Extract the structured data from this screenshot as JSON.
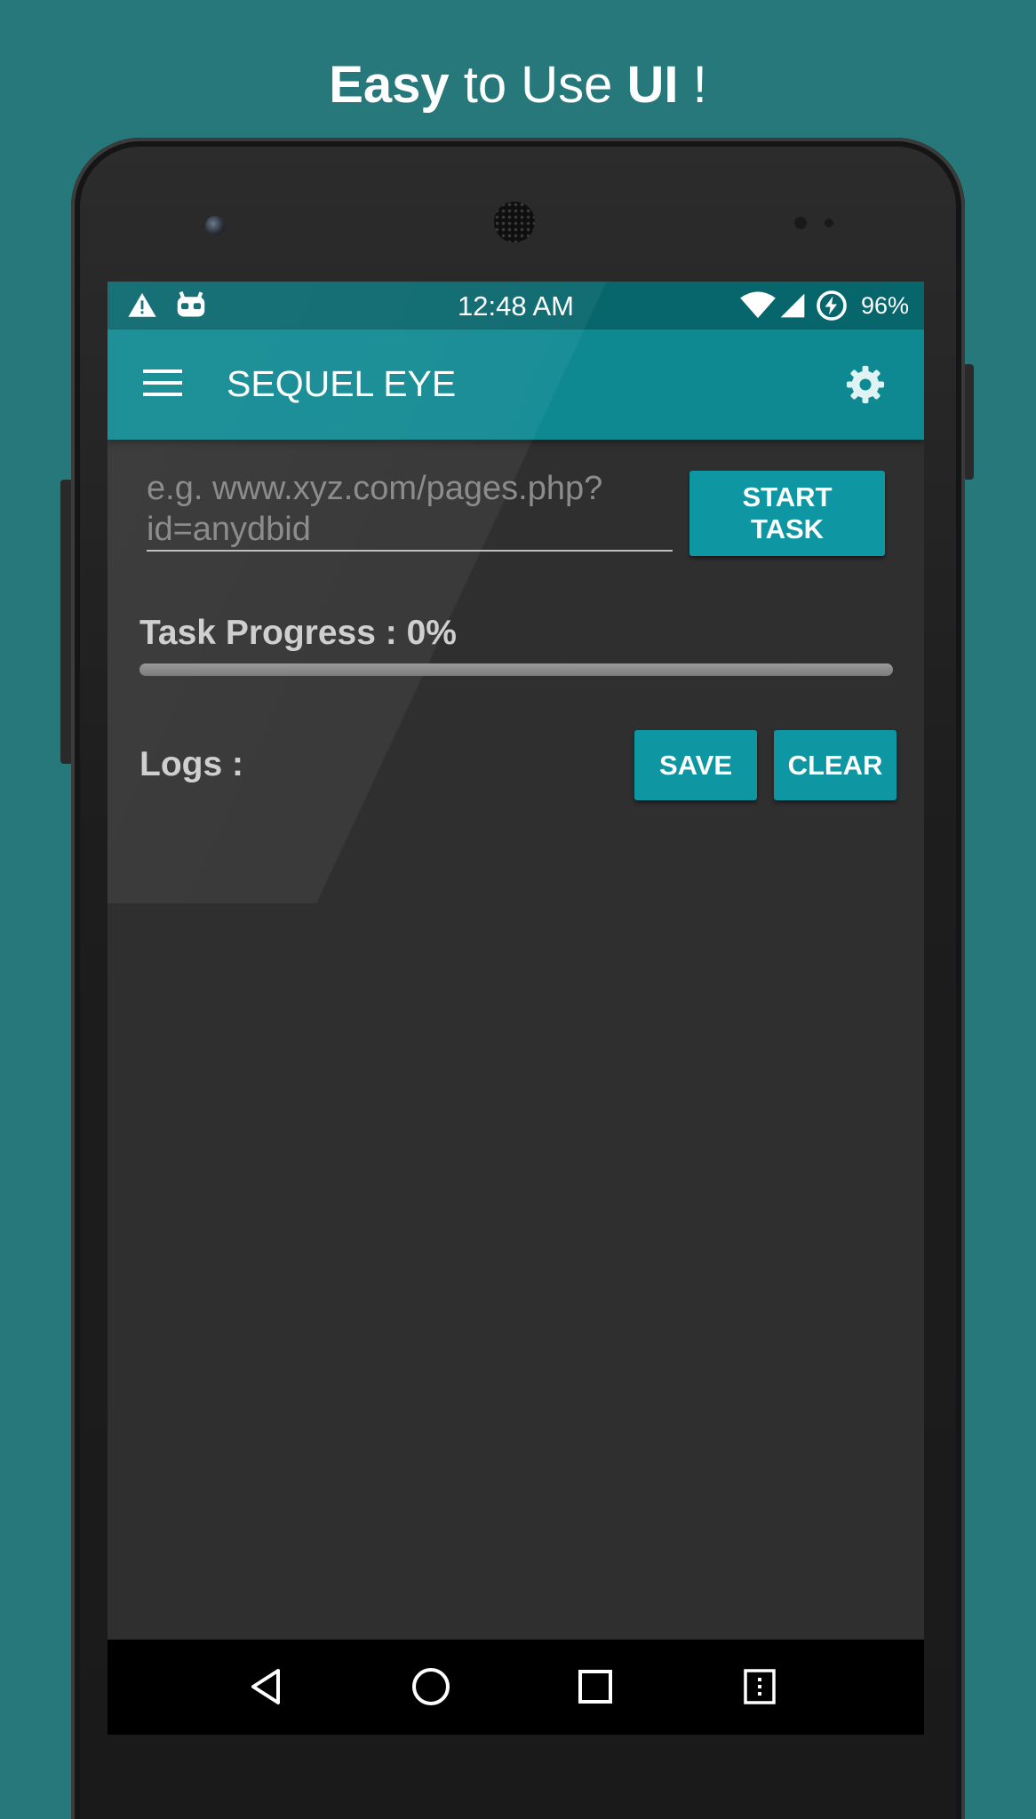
{
  "headline": {
    "word1": "Easy",
    "word2": " to Use ",
    "word3": "UI",
    "word4": " !"
  },
  "status_bar": {
    "time": "12:48 AM",
    "battery": "96%",
    "icons": [
      "warning-icon",
      "android-bot-icon",
      "wifi-icon",
      "cell-signal-icon",
      "battery-charging-icon"
    ]
  },
  "app_bar": {
    "title": "SEQUEL EYE",
    "icons": [
      "menu-icon",
      "gear-icon"
    ]
  },
  "url_input": {
    "value": "",
    "placeholder": "e.g. www.xyz.com/pages.php?id=anydbid"
  },
  "buttons": {
    "start_line1": "START",
    "start_line2": "TASK",
    "save": "SAVE",
    "clear": "CLEAR"
  },
  "progress": {
    "label": "Task Progress : 0%",
    "value_percent": 0
  },
  "logs": {
    "label": "Logs :"
  },
  "nav_bar": {
    "icons": [
      "back-icon",
      "home-icon",
      "recents-icon",
      "overflow-menu-icon"
    ]
  },
  "colors": {
    "background": "#26787a",
    "app_bar": "#0e8891",
    "status_bar": "#06666c",
    "button": "#0e97a3",
    "screen": "#2f2f2f"
  }
}
